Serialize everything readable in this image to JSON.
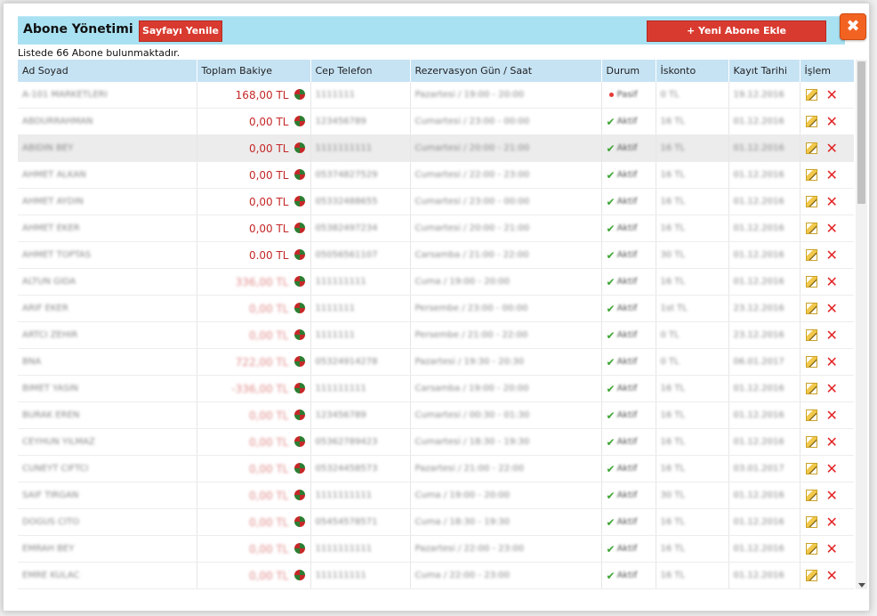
{
  "header": {
    "title": "Abone Yönetimi",
    "refresh_label": "Sayfayı Yenile",
    "add_label": "+ Yeni Abone Ekle",
    "close_glyph": "✖"
  },
  "summary": "Listede 66 Abone bulunmaktadır.",
  "columns": [
    "Ad Soyad",
    "Toplam Bakiye",
    "Cep Telefon",
    "Rezervasyon Gün / Saat",
    "Durum",
    "İskonto",
    "Kayıt Tarihi",
    "İşlem"
  ],
  "rows": [
    {
      "name": "A-101 MARKETLERI",
      "balance": "168,00 TL",
      "blurred": false,
      "phone": "1111111",
      "res": "Pazartesi / 19:00 - 20:00",
      "status": "Pasif",
      "active": false,
      "disc": "0 TL",
      "date": "19.12.2016"
    },
    {
      "name": "ABDURRAHMAN",
      "balance": "0,00 TL",
      "blurred": false,
      "phone": "123456789",
      "res": "Cumartesi / 23:00 - 00:00",
      "status": "Aktif",
      "active": true,
      "disc": "16 TL",
      "date": "01.12.2016"
    },
    {
      "name": "ABIDIN BEY",
      "balance": "0,00 TL",
      "blurred": false,
      "phone": "1111111111",
      "res": "Cumartesi / 20:00 - 21:00",
      "status": "Aktif",
      "active": true,
      "disc": "16 TL",
      "date": "01.12.2016"
    },
    {
      "name": "AHMET ALKAN",
      "balance": "0,00 TL",
      "blurred": false,
      "phone": "05374827529",
      "res": "Cumartesi / 22:00 - 23:00",
      "status": "Aktif",
      "active": true,
      "disc": "16 TL",
      "date": "01.12.2016"
    },
    {
      "name": "AHMET AYDIN",
      "balance": "0,00 TL",
      "blurred": false,
      "phone": "05332488655",
      "res": "Cumartesi / 23:00 - 00:00",
      "status": "Aktif",
      "active": true,
      "disc": "16 TL",
      "date": "01.12.2016"
    },
    {
      "name": "AHMET EKER",
      "balance": "0,00 TL",
      "blurred": false,
      "phone": "05382497234",
      "res": "Cumartesi / 20:00 - 21:00",
      "status": "Aktif",
      "active": true,
      "disc": "16 TL",
      "date": "01.12.2016"
    },
    {
      "name": "AHMET TOPTAS",
      "balance": "0.00 TL",
      "blurred": false,
      "phone": "05056561107",
      "res": "Carsamba / 21:00 - 22:00",
      "status": "Aktif",
      "active": true,
      "disc": "30 TL",
      "date": "01.12.2016"
    },
    {
      "name": "ALTUN GIDA",
      "balance": "336,00 TL",
      "blurred": true,
      "phone": "111111111",
      "res": "Cuma / 19:00 - 20:00",
      "status": "Aktif",
      "active": true,
      "disc": "16 TL",
      "date": "01.12.2016"
    },
    {
      "name": "ARIF EKER",
      "balance": "0,00 TL",
      "blurred": true,
      "phone": "1111111",
      "res": "Persembe / 23:00 - 00:00",
      "status": "Aktif",
      "active": true,
      "disc": "1st TL",
      "date": "23.12.2016"
    },
    {
      "name": "ARTCI ZEHIR",
      "balance": "0,00 TL",
      "blurred": true,
      "phone": "1111111",
      "res": "Persembe / 21:00 - 22:00",
      "status": "Aktif",
      "active": true,
      "disc": "0 TL",
      "date": "23.12.2016"
    },
    {
      "name": "BNA",
      "balance": "722,00 TL",
      "blurred": true,
      "phone": "05324914278",
      "res": "Pazartesi / 19:30 - 20:30",
      "status": "Aktif",
      "active": true,
      "disc": "0 TL",
      "date": "06.01.2017"
    },
    {
      "name": "BIMET YASIN",
      "balance": "-336,00 TL",
      "blurred": true,
      "phone": "111111111",
      "res": "Carsamba / 19:00 - 20:00",
      "status": "Aktif",
      "active": true,
      "disc": "16 TL",
      "date": "01.12.2016"
    },
    {
      "name": "BURAK EREN",
      "balance": "0,00 TL",
      "blurred": true,
      "phone": "123456789",
      "res": "Cumartesi / 00:30 - 01:30",
      "status": "Aktif",
      "active": true,
      "disc": "16 TL",
      "date": "01.12.2016"
    },
    {
      "name": "CEYHUN YILMAZ",
      "balance": "0,00 TL",
      "blurred": true,
      "phone": "05362789423",
      "res": "Cumartesi / 18:30 - 19:30",
      "status": "Aktif",
      "active": true,
      "disc": "16 TL",
      "date": "01.12.2016"
    },
    {
      "name": "CUNEYT CIFTCI",
      "balance": "0,00 TL",
      "blurred": true,
      "phone": "05324458573",
      "res": "Pazartesi / 21:00 - 22:00",
      "status": "Aktif",
      "active": true,
      "disc": "16 TL",
      "date": "03.01.2017"
    },
    {
      "name": "SAIF TIRGAN",
      "balance": "0,00 TL",
      "blurred": true,
      "phone": "1111111111",
      "res": "Cuma / 19:00 - 20:00",
      "status": "Aktif",
      "active": true,
      "disc": "30 TL",
      "date": "01.12.2016"
    },
    {
      "name": "DOGUS CITO",
      "balance": "0,00 TL",
      "blurred": true,
      "phone": "05454578571",
      "res": "Cuma / 18:30 - 19:30",
      "status": "Aktif",
      "active": true,
      "disc": "16 TL",
      "date": "01.12.2016"
    },
    {
      "name": "EMRAH BEY",
      "balance": "0,00 TL",
      "blurred": true,
      "phone": "1111111111",
      "res": "Pazartesi / 22:00 - 23:00",
      "status": "Aktif",
      "active": true,
      "disc": "16 TL",
      "date": "01.12.2016"
    },
    {
      "name": "EMRE KULAC",
      "balance": "0,00 TL",
      "blurred": true,
      "phone": "111111111",
      "res": "Cuma / 22:00 - 23:00",
      "status": "Aktif",
      "active": true,
      "disc": "16 TL",
      "date": "01.12.2016"
    }
  ]
}
